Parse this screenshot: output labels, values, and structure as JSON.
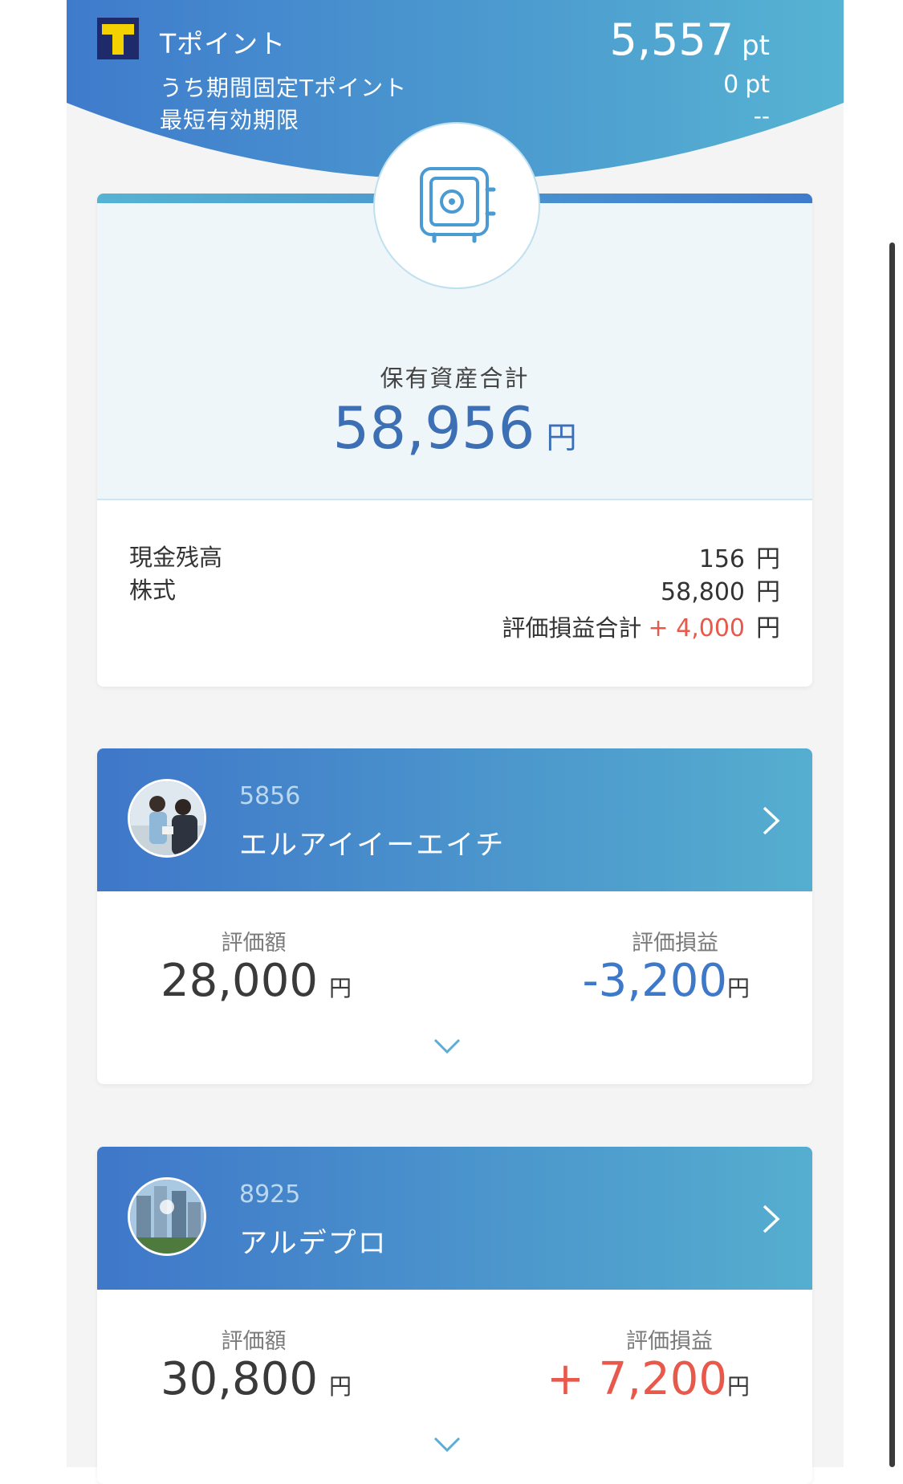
{
  "header": {
    "title": "Tポイント",
    "points": "5,557",
    "points_unit": "pt",
    "fixed_label": "うち期間固定Tポイント",
    "fixed_value": "0",
    "fixed_unit": "pt",
    "expiry_label": "最短有効期限",
    "expiry_value": "--"
  },
  "summary": {
    "label": "保有資産合計",
    "total": "58,956",
    "total_unit": "円",
    "cash_label": "現金残高",
    "cash_value": "156",
    "cash_unit": "円",
    "stocks_label": "株式",
    "stocks_value": "58,800",
    "stocks_unit": "円",
    "pl_label": "評価損益合計",
    "pl_value": "+ 4,000",
    "pl_unit": "円"
  },
  "stocks": [
    {
      "code": "5856",
      "name": "エルアイイーエイチ",
      "value_label": "評価額",
      "value": "28,000",
      "value_unit": "円",
      "pl_label": "評価損益",
      "pl": "-3,200",
      "pl_unit": "円"
    },
    {
      "code": "8925",
      "name": "アルデプロ",
      "value_label": "評価額",
      "value": "30,800",
      "value_unit": "円",
      "pl_label": "評価損益",
      "pl": "+ 7,200",
      "pl_unit": "円"
    }
  ],
  "icons": {
    "safe": "safe-icon",
    "right": "chevron-right-icon",
    "down": "chevron-down-icon",
    "logo": "t-point-logo"
  },
  "colors": {
    "header_start": "#3f7bcc",
    "header_end": "#56b3d2",
    "positive": "#e8594c",
    "negative": "#3d78c9",
    "total": "#3d6fb5"
  }
}
